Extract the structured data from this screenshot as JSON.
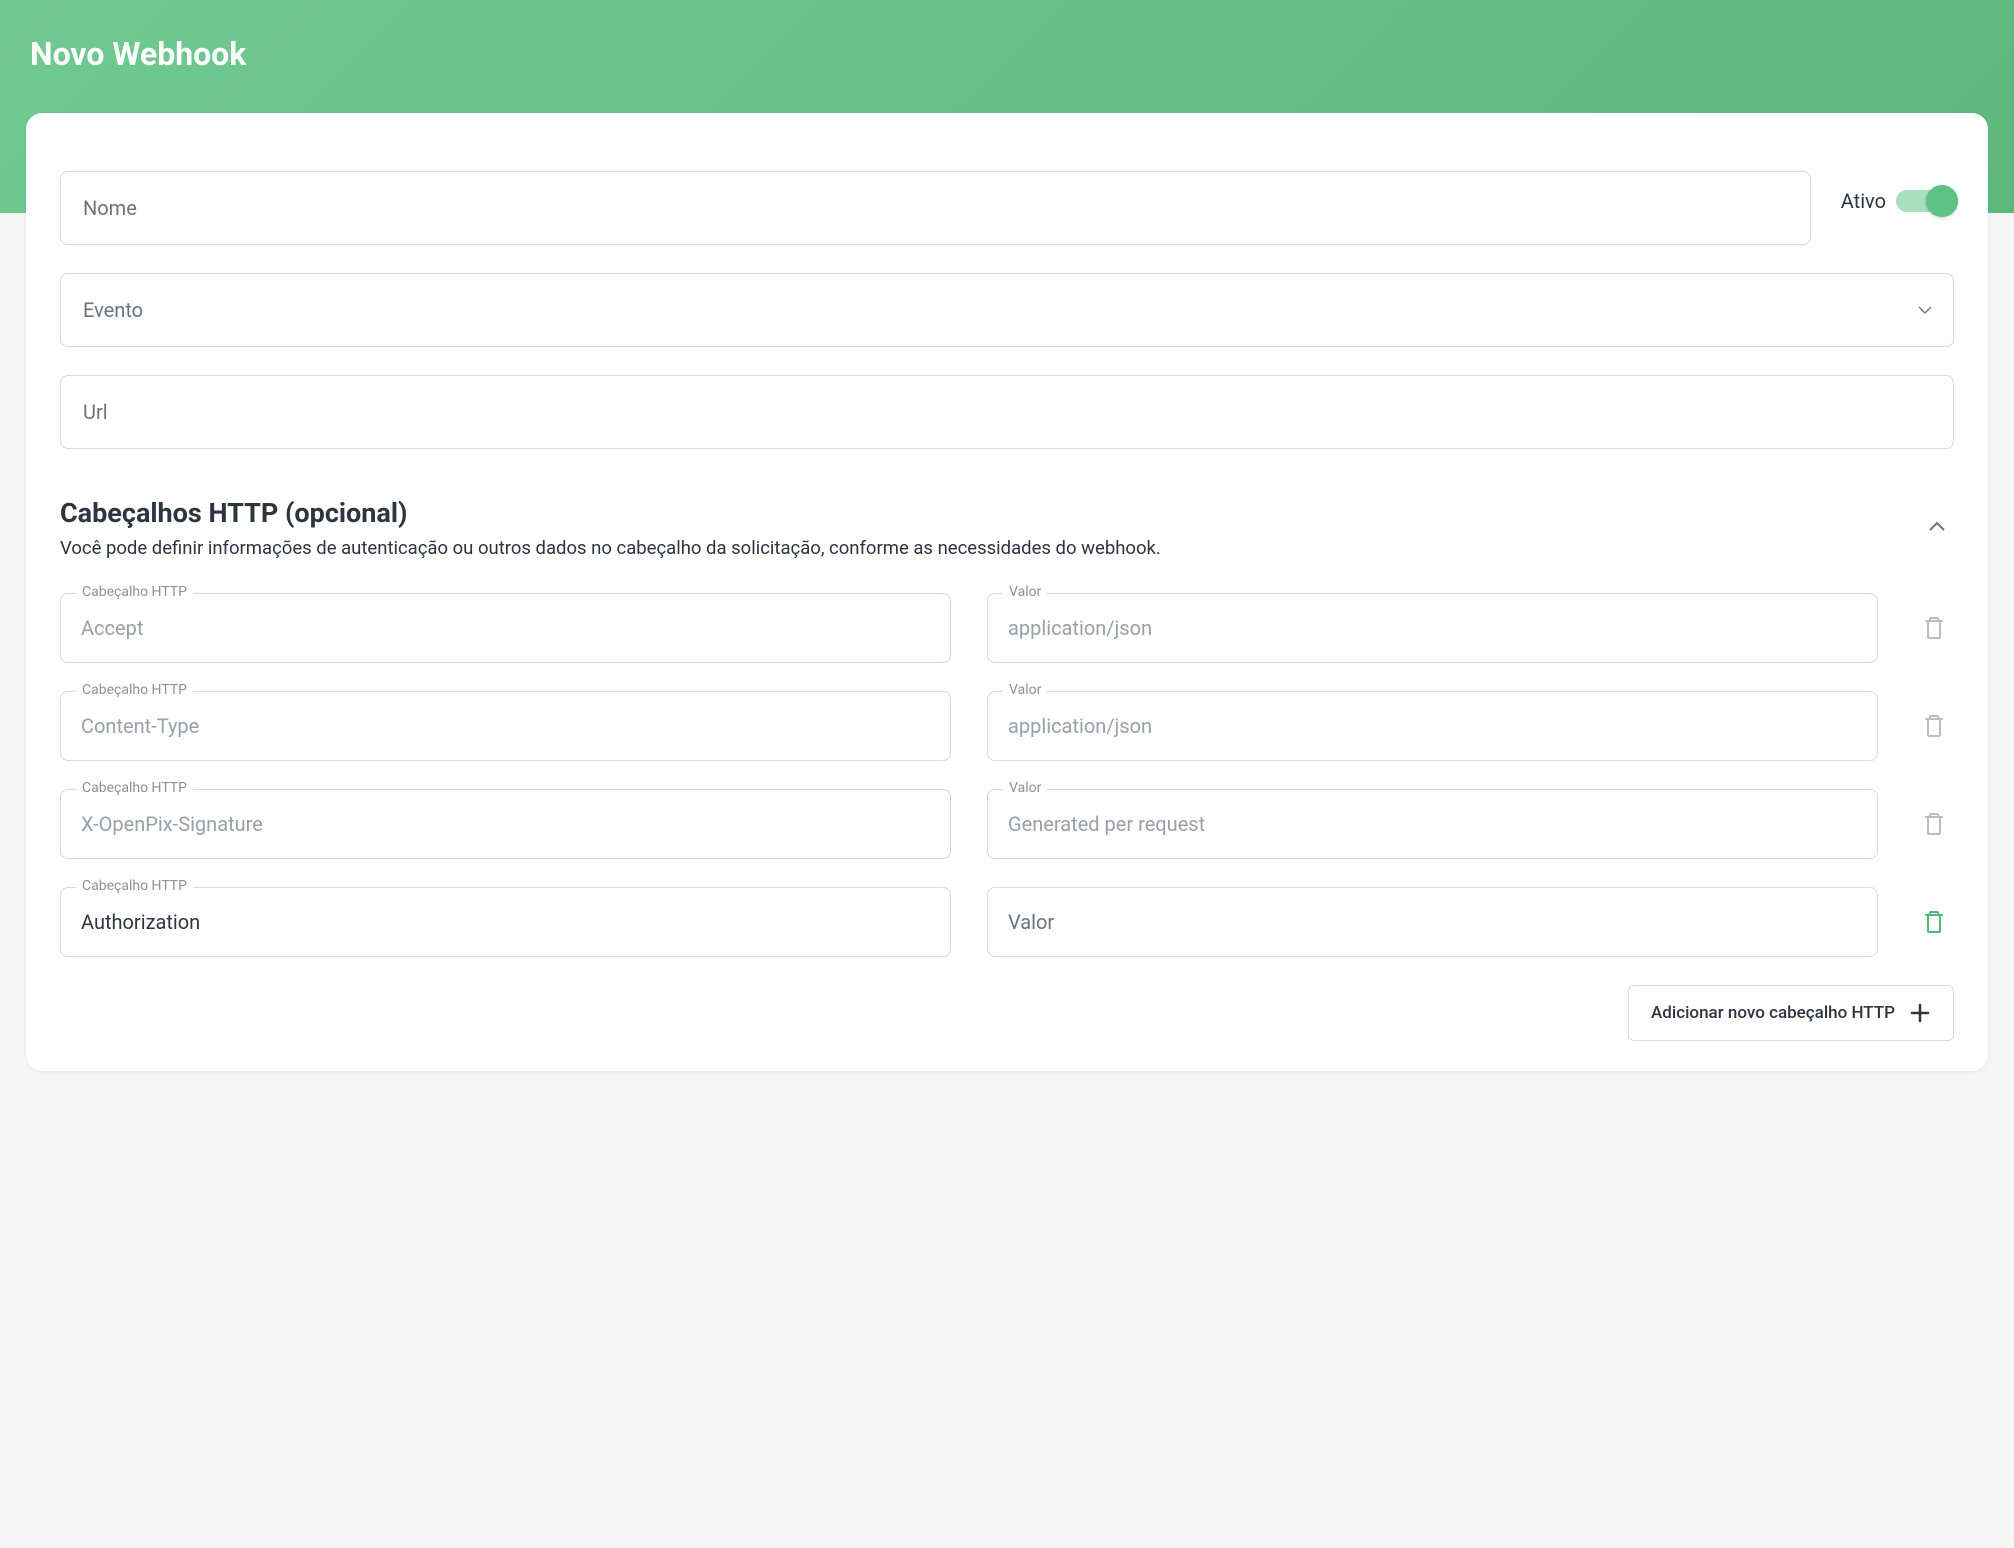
{
  "page": {
    "title": "Novo Webhook"
  },
  "form": {
    "name_placeholder": "Nome",
    "active_label": "Ativo",
    "event_placeholder": "Evento",
    "url_placeholder": "Url"
  },
  "http_headers": {
    "section_title": "Cabeçalhos HTTP (opcional)",
    "section_description": "Você pode definir informações de autenticação ou outros dados no cabeçalho da solicitação, conforme as necessidades do webhook.",
    "header_label": "Cabeçalho HTTP",
    "value_label": "Valor",
    "rows": [
      {
        "header": "Accept",
        "value": "application/json",
        "disabled": true,
        "delete_active": false
      },
      {
        "header": "Content-Type",
        "value": "application/json",
        "disabled": true,
        "delete_active": false
      },
      {
        "header": "X-OpenPix-Signature",
        "value": "Generated per request",
        "disabled": true,
        "delete_active": false
      },
      {
        "header": "Authorization",
        "value": "",
        "value_placeholder": "Valor",
        "disabled": false,
        "delete_active": true
      }
    ],
    "add_button_label": "Adicionar novo cabeçalho HTTP"
  }
}
